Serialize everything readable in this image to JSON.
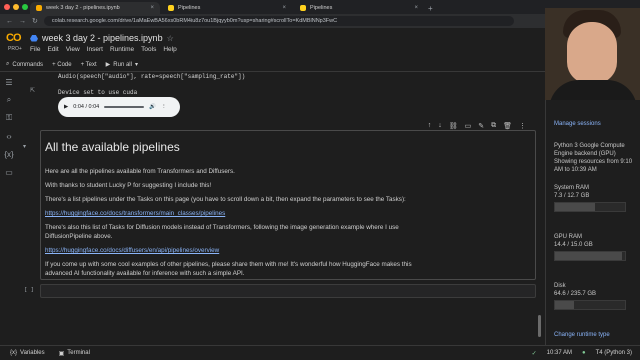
{
  "browser": {
    "tabs": [
      {
        "label": "week 3 day 2 - pipelines.ipynb",
        "active": true
      },
      {
        "label": "Pipelines",
        "active": false
      },
      {
        "label": "Pipelines",
        "active": false
      }
    ],
    "url": "colab.research.google.com/drive/1aMaEwBA56xs0bRM4iu8z7ou1Bjqyyb0m?usp=sharing#scrollTo=KdMBlNNp3FwC"
  },
  "colab": {
    "logo": "CO",
    "plan": "PRO+",
    "doc_title": "week 3 day 2 - pipelines.ipynb",
    "menu": [
      "File",
      "Edit",
      "View",
      "Insert",
      "Runtime",
      "Tools",
      "Help"
    ]
  },
  "toolbar": {
    "commands": "Commands",
    "code": "+ Code",
    "text": "+ Text",
    "run_all": "Run all"
  },
  "output": {
    "code_line": "Audio(speech[\"audio\"], rate=speech[\"sampling_rate\"])",
    "stdout": "Device set to use cuda",
    "audio_time": "0:04 / 0:04"
  },
  "text_cell": {
    "heading": "All the available pipelines",
    "p1": "Here are all the pipelines available from Transformers and Diffusers.",
    "p2": "With thanks to student Lucky P for suggesting I include this!",
    "p3": "There's a list pipelines under the Tasks on this page (you have to scroll down a bit, then expand the parameters to see the Tasks):",
    "link1": "https://huggingface.co/docs/transformers/main_classes/pipelines",
    "p4a": "There's also this list of Tasks for Diffusion models instead of Transformers, following the image generation example where I use",
    "p4b": "DiffusionPipeline above.",
    "link2": "https://huggingface.co/docs/diffusers/en/api/pipelines/overview",
    "p5a": "If you come up with some cool examples of other pipelines, please share them with me! It's wonderful how HuggingFace makes this",
    "p5b": "advanced AI functionality available for inference with such a simple API."
  },
  "empty_cell": {
    "bracket": "[ ]"
  },
  "resources": {
    "manage": "Manage sessions",
    "runtime": "Python 3 Google Compute Engine backend (GPU)",
    "showing": "Showing resources from 9:10 AM to 10:39 AM",
    "system_ram_label": "System RAM",
    "system_ram_value": "7.3 / 12.7 GB",
    "system_ram_fraction": 0.57,
    "gpu_ram_label": "GPU RAM",
    "gpu_ram_value": "14.4 / 15.0 GB",
    "gpu_ram_fraction": 0.96,
    "disk_label": "Disk",
    "disk_value": "64.6 / 235.7 GB",
    "disk_fraction": 0.27,
    "change_runtime": "Change runtime type"
  },
  "statusbar": {
    "variables": "Variables",
    "terminal": "Terminal",
    "time": "10:37 AM",
    "runtime": "T4 (Python 3)"
  },
  "colors": {
    "accent": "#f9ab00",
    "link": "#8ab4f8",
    "background": "#1e1e1e"
  }
}
